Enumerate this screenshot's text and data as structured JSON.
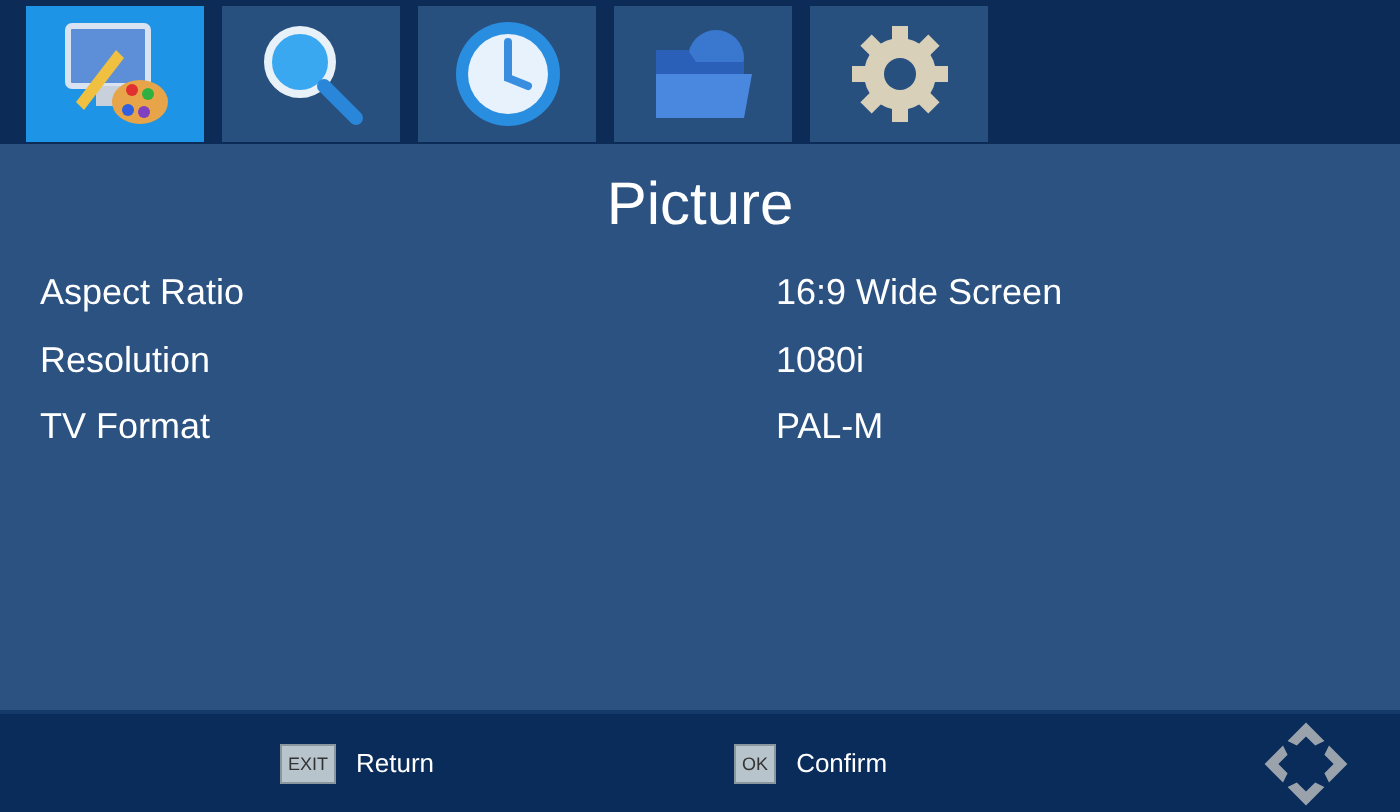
{
  "tabs": [
    {
      "kind": "picture",
      "selected": true
    },
    {
      "kind": "search",
      "selected": false
    },
    {
      "kind": "time",
      "selected": false
    },
    {
      "kind": "folder",
      "selected": false
    },
    {
      "kind": "settings",
      "selected": false
    }
  ],
  "title": "Picture",
  "settings": [
    {
      "label": "Aspect Ratio",
      "value": "16:9 Wide Screen"
    },
    {
      "label": "Resolution",
      "value": "1080i"
    },
    {
      "label": "TV Format",
      "value": "PAL-M"
    }
  ],
  "footer": [
    {
      "key": "EXIT",
      "action": "Return"
    },
    {
      "key": "OK",
      "action": "Confirm"
    }
  ]
}
